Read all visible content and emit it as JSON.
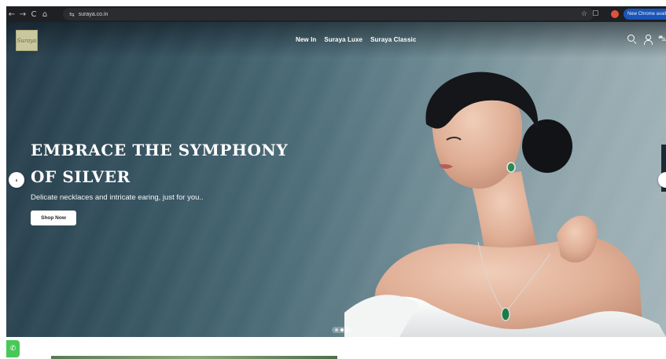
{
  "browser": {
    "url": "suraya.co.in",
    "update_label": "New Chrome available",
    "nav_back": "←",
    "nav_forward": "→",
    "nav_reload": "C",
    "nav_home": "⌂",
    "site_settings_glyph": "⇆",
    "bookmark_glyph": "☆",
    "extension_glyph": "▢"
  },
  "site": {
    "logo_text": "Suraya",
    "nav": [
      "New In",
      "Suraya Luxe",
      "Suraya Classic"
    ],
    "cart_glyph": "⛍"
  },
  "hero": {
    "title": "Embrace the Symphony of Silver",
    "subtitle": "Delicate necklaces and intricate earing, just for you..",
    "cta": "Shop Now",
    "prev_glyph": "‹",
    "slide_count": 3,
    "active_slide": 2
  },
  "widgets": {
    "whatsapp_glyph": "✆"
  },
  "colors": {
    "hero_dark": "#263c4a",
    "hero_light": "#a4b6bb",
    "update_button": "#1a56b8",
    "whatsapp": "#48c858"
  }
}
